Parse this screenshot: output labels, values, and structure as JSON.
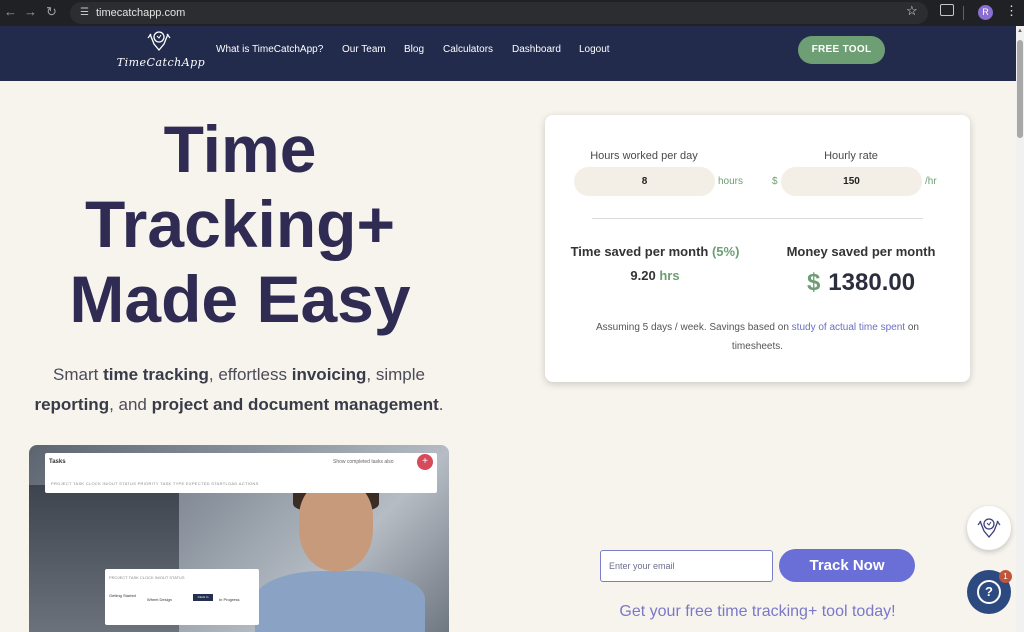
{
  "browser": {
    "url": "timecatchapp.com",
    "profile_initial": "R"
  },
  "nav": {
    "logo_text": "TimeCatchApp",
    "links": [
      "What is TimeCatchApp?",
      "Our Team",
      "Blog",
      "Calculators",
      "Dashboard",
      "Logout"
    ],
    "cta": "FREE TOOL"
  },
  "hero": {
    "title_line1": "Time",
    "title_line2": "Tracking+",
    "title_line3": "Made Easy",
    "subtitle": {
      "t1": "Smart ",
      "b1": "time tracking",
      "t2": ", effortless ",
      "b2": "invoicing",
      "t3": ", simple ",
      "b3": "reporting",
      "t4": ", and ",
      "b4": "project and document management",
      "t5": "."
    }
  },
  "preview": {
    "tasks_title": "Tasks",
    "show_completed": "Show completed tasks also",
    "columns": "PROJECT          TASK          CLOCK IN/OUT     STATUS     PRIORITY     TASK TYPE     EXPECTED     STARTLOAD     ACTIONS",
    "sub_columns": "PROJECT     TASK     CLOCK IN/OUT     STATUS",
    "row_project": "Getting Started",
    "row_task": "Wheel Design",
    "row_clock": "Clock In",
    "row_status": "In Progress"
  },
  "calculator": {
    "hours_label": "Hours worked per day",
    "hours_value": "8",
    "hours_unit": "hours",
    "rate_label": "Hourly rate",
    "rate_currency": "$",
    "rate_value": "150",
    "rate_unit": "/hr",
    "time_saved_label": "Time saved per month ",
    "time_saved_pct": "(5%)",
    "time_saved_value": "9.20",
    "time_saved_unit": "hrs",
    "money_saved_label": "Money saved per month",
    "money_currency": "$",
    "money_value": "1380.00",
    "note_prefix": "Assuming 5 days / week. Savings based on ",
    "note_link": "study of actual time spent",
    "note_suffix": " on timesheets."
  },
  "signup": {
    "email_placeholder": "Enter your email",
    "button": "Track Now",
    "tagline": "Get your free time tracking+ tool today!"
  },
  "widgets": {
    "help_badge": "1"
  },
  "colors": {
    "nav_bg": "#222b4c",
    "accent_green": "#6d9e74",
    "accent_purple": "#6a6fd8",
    "title_color": "#2f2b53"
  }
}
